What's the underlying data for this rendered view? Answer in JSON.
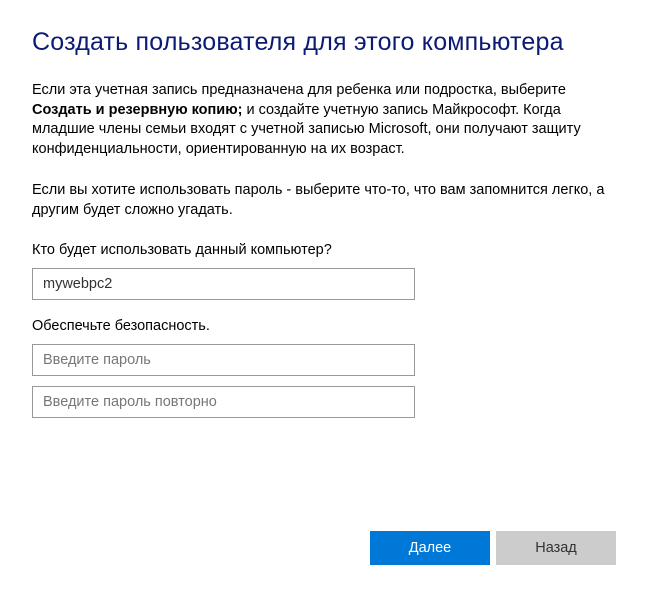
{
  "title": "Создать пользователя для этого компьютера",
  "description": {
    "part1": "Если эта учетная запись предназначена для ребенка или подростка, выберите ",
    "bold": "Создать и резервную копию;",
    "part2": " и создайте учетную запись Майкрософт. Когда младшие члены семьи входят с учетной записью Microsoft, они получают защиту конфиденциальности, ориентированную на их возраст."
  },
  "password_hint": "Если вы хотите использовать пароль - выберите что-то, что вам запомнится легко, а другим будет сложно угадать.",
  "username_label": "Кто будет использовать данный компьютер?",
  "username_value": "mywebpc2",
  "security_label": "Обеспечьте безопасность.",
  "password_placeholder": "Введите пароль",
  "password_confirm_placeholder": "Введите пароль повторно",
  "buttons": {
    "next": "Далее",
    "back": "Назад"
  }
}
